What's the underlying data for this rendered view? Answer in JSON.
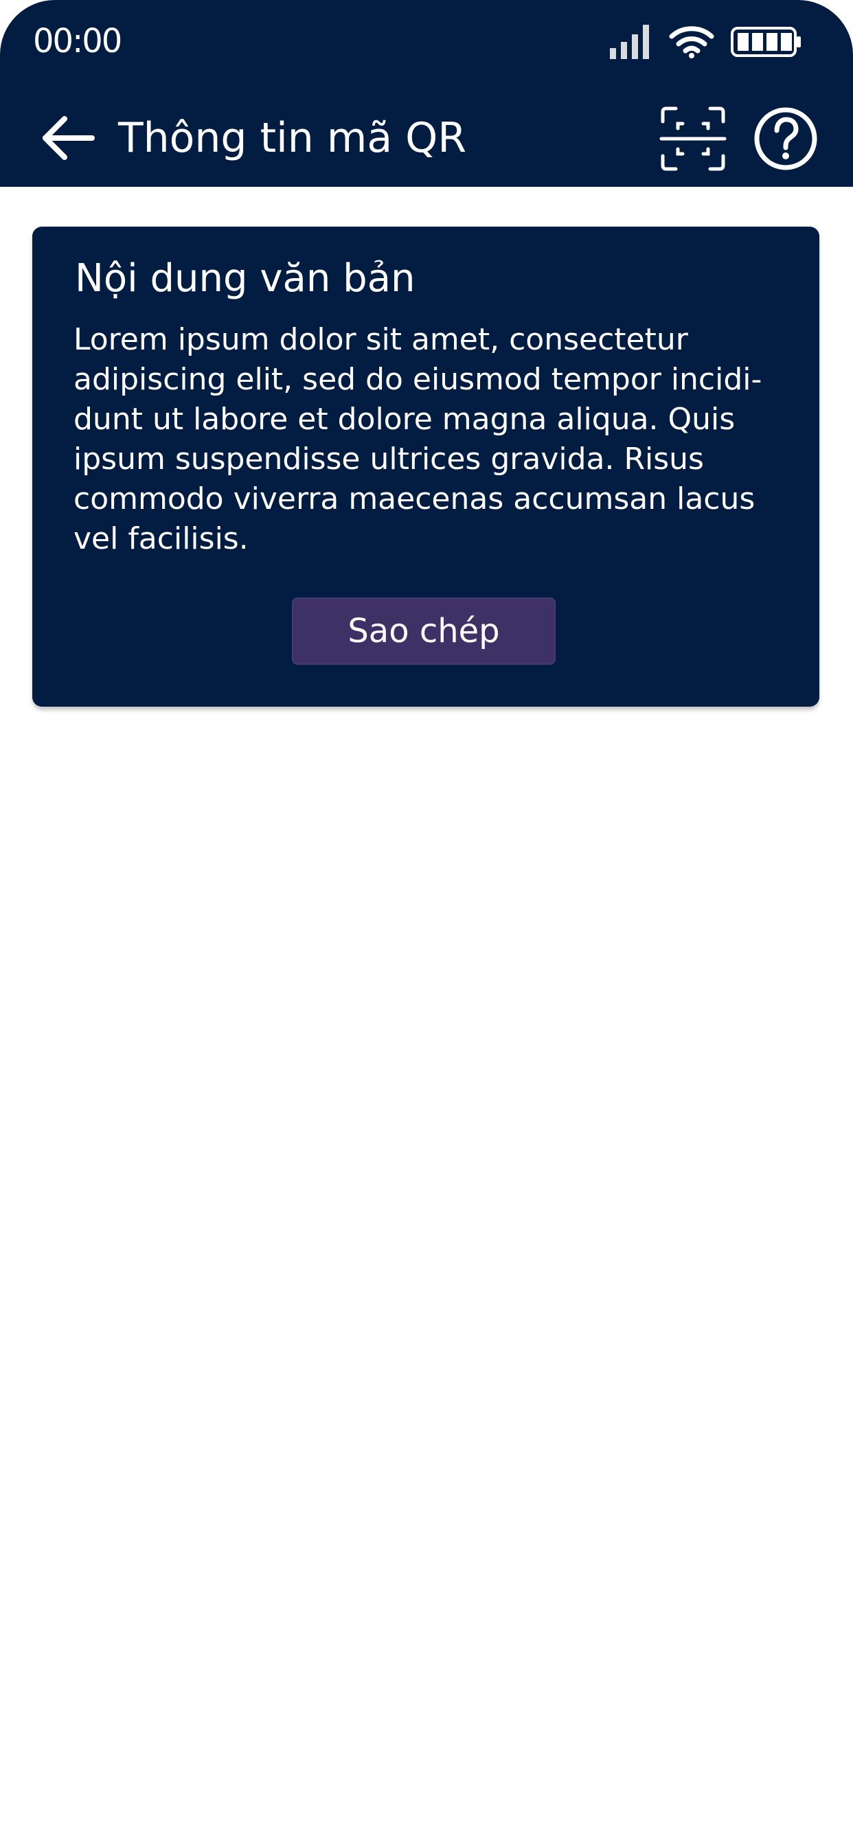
{
  "status_bar": {
    "time": "00:00",
    "icons": [
      "signal-icon",
      "wifi-icon",
      "battery-icon"
    ]
  },
  "header": {
    "title": "Thông tin mã QR",
    "back_icon": "back-arrow-icon",
    "actions": [
      "qr-scan-icon",
      "help-icon"
    ]
  },
  "card": {
    "title": "Nội dung văn bản",
    "body": "Lorem ipsum dolor sit amet, consectetur\nadipiscing elit, sed do eiusmod tempor incidi-\ndunt ut labore et dolore magna aliqua. Quis\nipsum suspendisse ultrices gravida. Risus\ncommodo viverra maecenas accumsan lacus\nvel facilisis.",
    "copy_label": "Sao chép"
  },
  "colors": {
    "primary_navy": "#031d42",
    "button_purple": "#3e3166",
    "background": "#ffffff",
    "text": "#ffffff"
  }
}
